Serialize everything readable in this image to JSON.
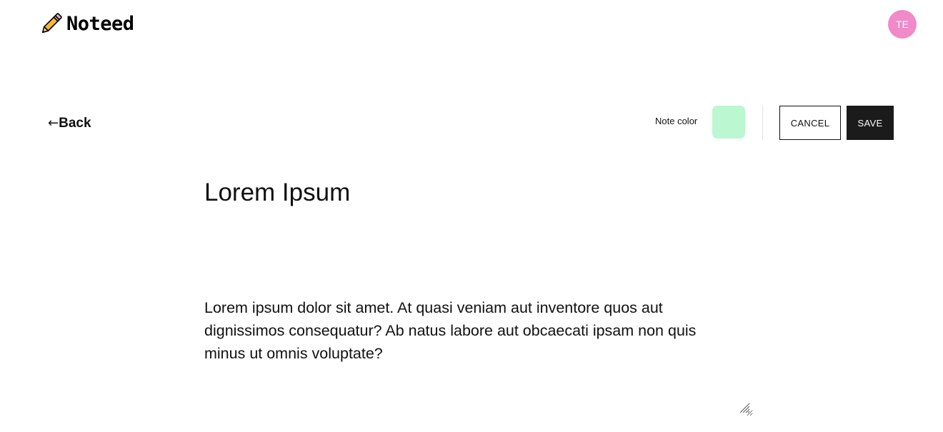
{
  "app": {
    "name": "Noteed",
    "logo_icon": "pencil-icon"
  },
  "user": {
    "initials": "TE",
    "avatar_color": "#f08ac8"
  },
  "toolbar": {
    "back_label": "Back",
    "back_icon": "←",
    "note_color_label": "Note color",
    "note_color": "#bbf7d0",
    "cancel_label": "CANCEL",
    "save_label": "SAVE"
  },
  "note": {
    "title": "Lorem Ipsum",
    "body": "Lorem ipsum dolor sit amet. At quasi veniam aut inventore quos aut dignissimos consequatur? Ab natus labore aut obcaecati ipsam non quis minus ut omnis voluptate?"
  }
}
